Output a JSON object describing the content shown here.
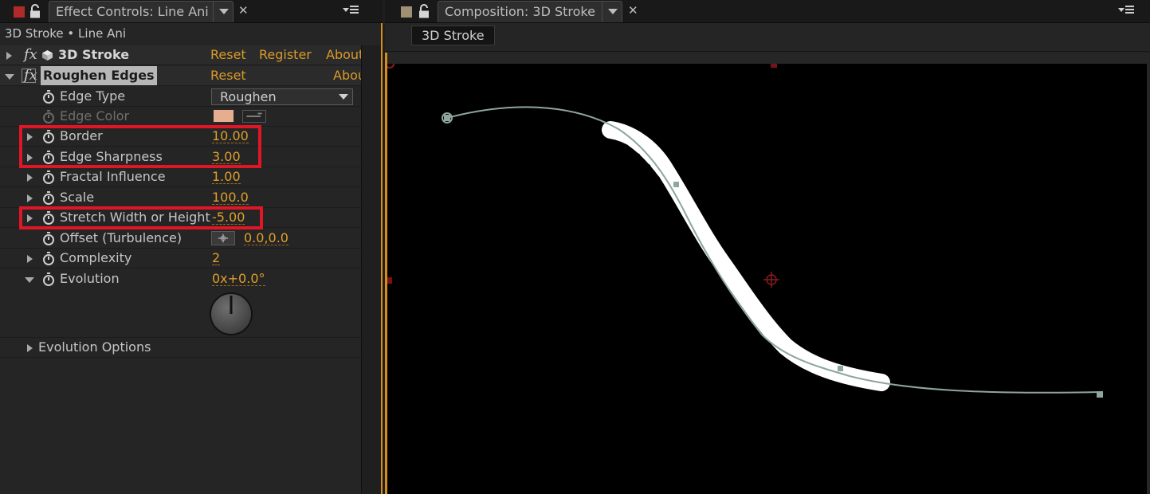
{
  "effect_controls": {
    "tab_title": "Effect Controls: Line Ani",
    "target_label": "3D Stroke • Line Ani",
    "effects": [
      {
        "name": "3D Stroke",
        "links": [
          "Reset",
          "Register",
          "About"
        ]
      },
      {
        "name": "Roughen Edges",
        "links": [
          "Reset",
          "Abou"
        ]
      }
    ],
    "params": {
      "edge_type": {
        "label": "Edge Type",
        "value": "Roughen"
      },
      "edge_color": {
        "label": "Edge Color",
        "color": "#e6ae8f"
      },
      "border": {
        "label": "Border",
        "value": "10.00"
      },
      "edge_sharpness": {
        "label": "Edge Sharpness",
        "value": "3.00"
      },
      "fractal_influence": {
        "label": "Fractal Influence",
        "value": "1.00"
      },
      "scale": {
        "label": "Scale",
        "value": "100.0"
      },
      "stretch": {
        "label": "Stretch Width or Height",
        "value": "-5.00"
      },
      "offset": {
        "label": "Offset (Turbulence)",
        "value": "0.0,0.0"
      },
      "complexity": {
        "label": "Complexity",
        "value": "2"
      },
      "evolution": {
        "label": "Evolution",
        "value": "0x+0.0°",
        "dial_degrees": 0
      },
      "evolution_options": {
        "label": "Evolution Options"
      }
    }
  },
  "composition": {
    "tab_title": "Composition: 3D Stroke",
    "comp_chip": "3D Stroke",
    "path_color": "#8fa5a0",
    "stroke_color": "#ffffff"
  },
  "colors": {
    "accent": "#e09f2a",
    "highlight": "#e01626",
    "panel_active": "#d58d1c"
  }
}
